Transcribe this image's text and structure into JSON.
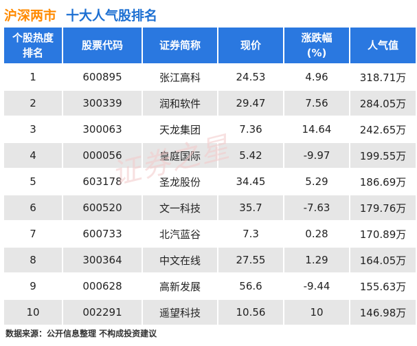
{
  "title": {
    "market": "沪深两市",
    "main": "十大人气股排名"
  },
  "watermark": "证券之星",
  "table": {
    "headers": [
      [
        "个股热度",
        "排名"
      ],
      [
        "股票代码"
      ],
      [
        "证券简称"
      ],
      [
        "现价"
      ],
      [
        "涨跌幅",
        "(%)"
      ],
      [
        "人气值"
      ]
    ],
    "rows": [
      [
        "1",
        "600895",
        "张江高科",
        "24.53",
        "4.96",
        "318.71万"
      ],
      [
        "2",
        "300339",
        "润和软件",
        "29.47",
        "7.56",
        "284.05万"
      ],
      [
        "3",
        "300063",
        "天龙集团",
        "7.36",
        "14.64",
        "242.65万"
      ],
      [
        "4",
        "000056",
        "皇庭国际",
        "5.42",
        "-9.97",
        "199.55万"
      ],
      [
        "5",
        "603178",
        "圣龙股份",
        "34.45",
        "5.29",
        "186.69万"
      ],
      [
        "6",
        "600520",
        "文一科技",
        "35.7",
        "-7.63",
        "179.76万"
      ],
      [
        "7",
        "600733",
        "北汽蓝谷",
        "7.3",
        "0.28",
        "170.89万"
      ],
      [
        "8",
        "300364",
        "中文在线",
        "27.55",
        "1.29",
        "164.05万"
      ],
      [
        "9",
        "000628",
        "高新发展",
        "56.6",
        "-9.44",
        "155.63万"
      ],
      [
        "10",
        "002291",
        "遥望科技",
        "10.56",
        "10",
        "146.98万"
      ]
    ]
  },
  "footer": "数据来源：公开信息整理  不构成投资建议"
}
